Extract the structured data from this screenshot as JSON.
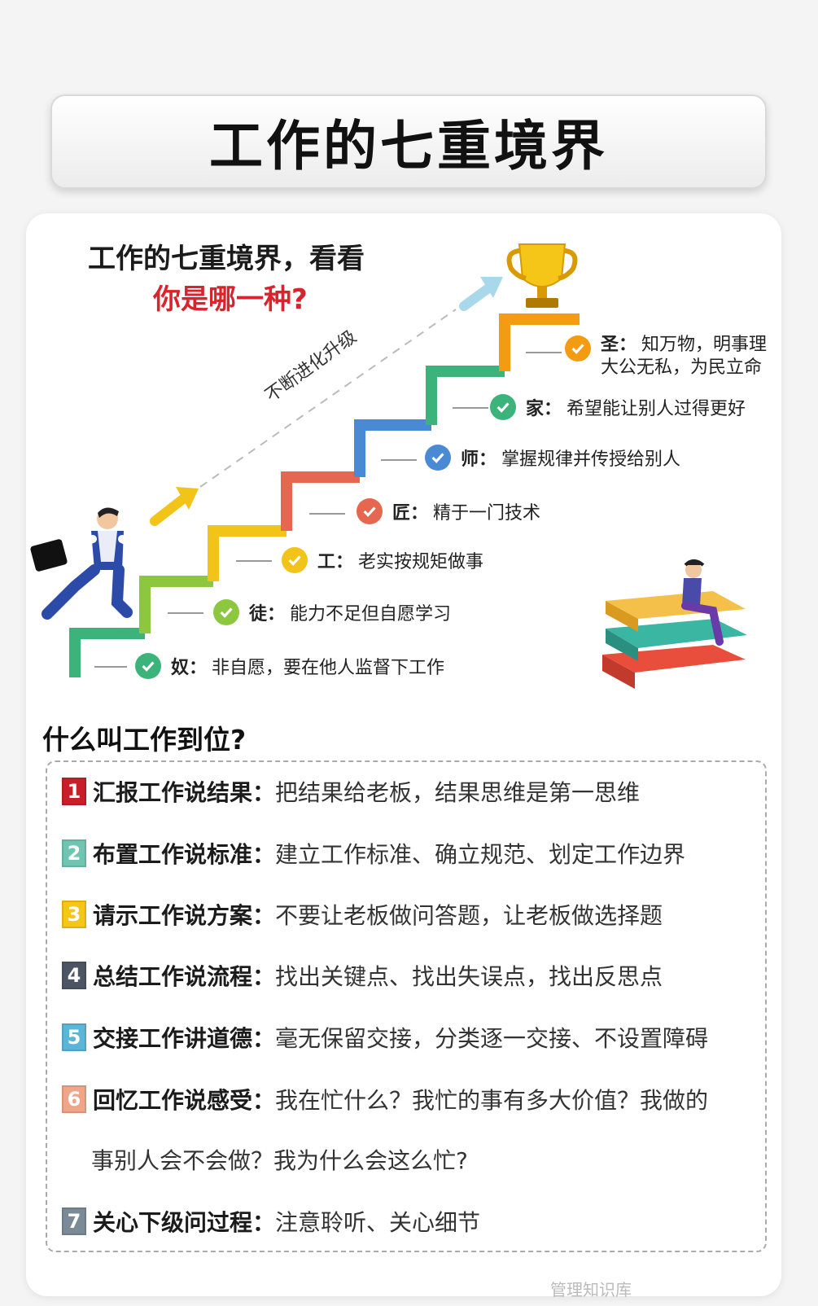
{
  "title": "工作的七重境界",
  "header": {
    "line1": "工作的七重境界，看看",
    "line2": "你是哪一种?"
  },
  "arrow_text": "不断进化升级",
  "levels": [
    {
      "key": "奴：",
      "desc": "非自愿，要在他人监督下工作",
      "color": "#3bb37a"
    },
    {
      "key": "徒：",
      "desc": "能力不足但自愿学习",
      "color": "#8dc63f"
    },
    {
      "key": "工：",
      "desc": "老实按规矩做事",
      "color": "#f2c318"
    },
    {
      "key": "匠：",
      "desc": "精于一门技术",
      "color": "#e6674f"
    },
    {
      "key": "师：",
      "desc": "掌握规律并传授给别人",
      "color": "#4a8ad4"
    },
    {
      "key": "家：",
      "desc": "希望能让别人过得更好",
      "color": "#3bb37a"
    },
    {
      "key": "圣：",
      "desc_line1": "知万物，明事理",
      "desc_line2": "大公无私，为民立命",
      "color": "#f39c12"
    }
  ],
  "section_title": "什么叫工作到位?",
  "items": [
    {
      "num": "1",
      "key": "汇报工作说结果：",
      "value": "把结果给老板，结果思维是第一思维",
      "color": "#c8202a"
    },
    {
      "num": "2",
      "key": "布置工作说标准：",
      "value": "建立工作标准、确立规范、划定工作边界",
      "color": "#6fc5b2"
    },
    {
      "num": "3",
      "key": "请示工作说方案：",
      "value": "不要让老板做问答题，让老板做选择题",
      "color": "#f5c518"
    },
    {
      "num": "4",
      "key": "总结工作说流程：",
      "value": "找出关键点、找出失误点，找出反思点",
      "color": "#4b5563"
    },
    {
      "num": "5",
      "key": "交接工作讲道德：",
      "value": "毫无保留交接，分类逐一交接、不设置障碍",
      "color": "#5bb5d6"
    },
    {
      "num": "6",
      "key": "回忆工作说感受：",
      "value": "我在忙什么？我忙的事有多大价值？我做的",
      "value_cont": "事别人会不会做？我为什么会这么忙?",
      "color": "#f0a58a"
    },
    {
      "num": "7",
      "key": "关心下级问过程：",
      "value": "注意聆听、关心细节",
      "color": "#7a8a96"
    }
  ],
  "watermark": "管理知识库"
}
